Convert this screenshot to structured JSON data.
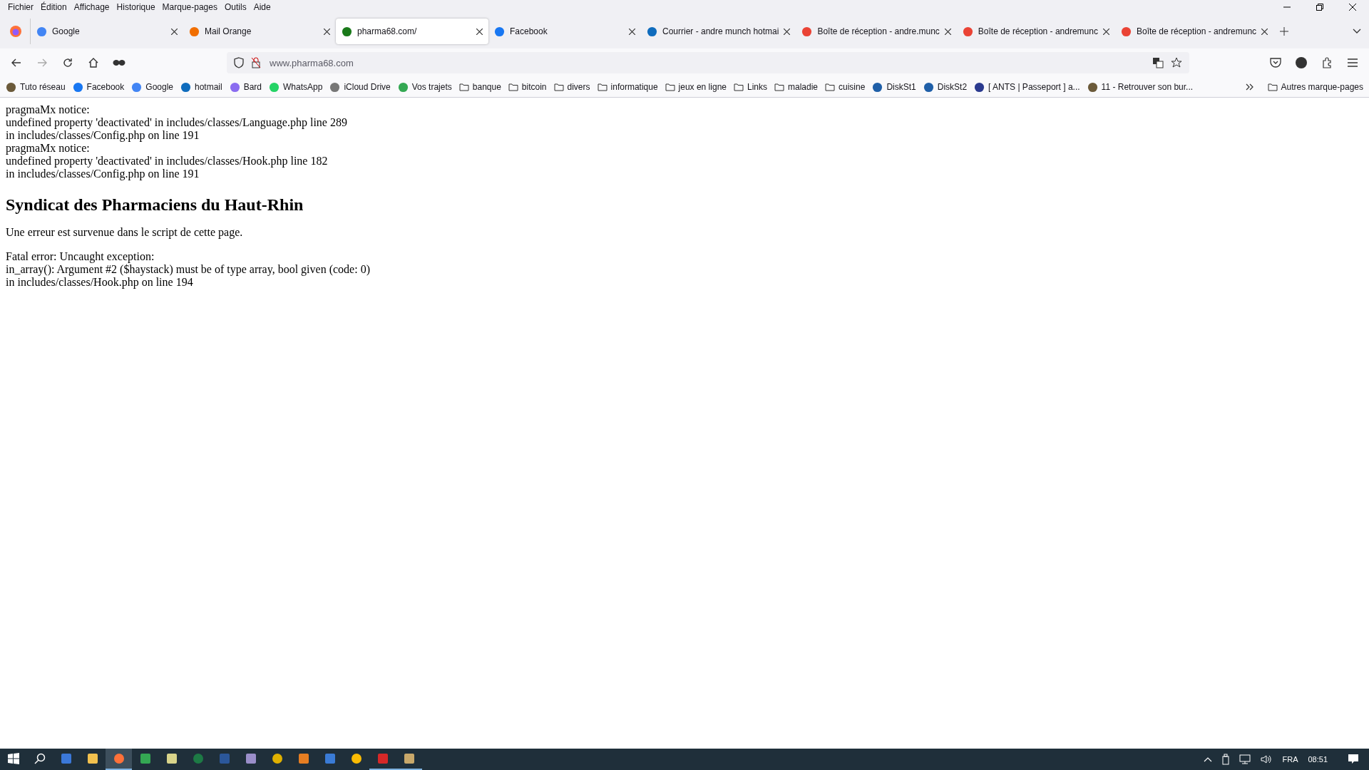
{
  "menu_bar": [
    "Fichier",
    "Édition",
    "Affichage",
    "Historique",
    "Marque-pages",
    "Outils",
    "Aide"
  ],
  "tabs": [
    {
      "label": "Google",
      "kind": "google",
      "selected": false
    },
    {
      "label": "Mail Orange",
      "kind": "mail",
      "selected": false
    },
    {
      "label": "pharma68.com/",
      "kind": "pharma",
      "selected": true
    },
    {
      "label": "Facebook",
      "kind": "facebook",
      "selected": false
    },
    {
      "label": "Courrier - andre munch hotmai",
      "kind": "outlook",
      "selected": false
    },
    {
      "label": "Boîte de réception - andre.munc",
      "kind": "gmail",
      "selected": false
    },
    {
      "label": "Boîte de réception - andremunc",
      "kind": "gmail",
      "selected": false
    },
    {
      "label": "Boîte de réception - andremunc",
      "kind": "gmail",
      "selected": false
    }
  ],
  "address_bar": {
    "value": "www.pharma68.com"
  },
  "bookmarks": [
    {
      "label": "Tuto réseau",
      "kind": "site"
    },
    {
      "label": "Facebook",
      "kind": "facebook"
    },
    {
      "label": "Google",
      "kind": "google"
    },
    {
      "label": "hotmail",
      "kind": "outlook"
    },
    {
      "label": "Bard",
      "kind": "sparkle"
    },
    {
      "label": "WhatsApp",
      "kind": "whatsapp"
    },
    {
      "label": "iCloud Drive",
      "kind": "apple"
    },
    {
      "label": "Vos trajets",
      "kind": "pin"
    },
    {
      "label": "banque",
      "kind": "folder"
    },
    {
      "label": "bitcoin",
      "kind": "folder"
    },
    {
      "label": "divers",
      "kind": "folder"
    },
    {
      "label": "informatique",
      "kind": "folder"
    },
    {
      "label": "jeux en ligne",
      "kind": "folder"
    },
    {
      "label": "Links",
      "kind": "folder"
    },
    {
      "label": "maladie",
      "kind": "folder"
    },
    {
      "label": "cuisine",
      "kind": "folder"
    },
    {
      "label": "DiskSt1",
      "kind": "disk"
    },
    {
      "label": "DiskSt2",
      "kind": "disk"
    },
    {
      "label": "[ ANTS | Passeport ] a...",
      "kind": "flag"
    },
    {
      "label": "11 - Retrouver son bur...",
      "kind": "site"
    }
  ],
  "other_bookmarks": "Autres marque-pages",
  "page": {
    "notices": [
      "pragmaMx notice:",
      "undefined property 'deactivated' in includes/classes/Language.php line 289",
      "in includes/classes/Config.php on line 191",
      "pragmaMx notice:",
      "undefined property 'deactivated' in includes/classes/Hook.php line 182",
      "in includes/classes/Config.php on line 191"
    ],
    "heading": "Syndicat des Pharmaciens du Haut-Rhin",
    "message": "Une erreur est survenue dans le script de cette page.",
    "error": [
      "Fatal error: Uncaught exception:",
      "in_array(): Argument #2 ($haystack) must be of type array, bool given (code: 0)",
      "in includes/classes/Hook.php on line 194"
    ]
  },
  "taskbar": {
    "apps": [
      {
        "kind": "letter-app",
        "selected": false,
        "running": false
      },
      {
        "kind": "folder",
        "selected": false,
        "running": false
      },
      {
        "kind": "fox",
        "selected": true,
        "running": true
      },
      {
        "kind": "chrome",
        "selected": false,
        "running": false
      },
      {
        "kind": "notepad",
        "selected": false,
        "running": false
      },
      {
        "kind": "sheet",
        "selected": false,
        "running": false
      },
      {
        "kind": "doc",
        "selected": false,
        "running": false
      },
      {
        "kind": "disc",
        "selected": false,
        "running": false
      },
      {
        "kind": "badge",
        "selected": false,
        "running": false
      },
      {
        "kind": "windows",
        "selected": false,
        "running": false
      },
      {
        "kind": "blue-round",
        "selected": false,
        "running": false
      },
      {
        "kind": "drive",
        "selected": false,
        "running": false
      },
      {
        "kind": "red-ball",
        "selected": false,
        "running": true
      },
      {
        "kind": "palette",
        "selected": false,
        "running": true
      }
    ],
    "language": "FRA",
    "time": "08:51"
  }
}
